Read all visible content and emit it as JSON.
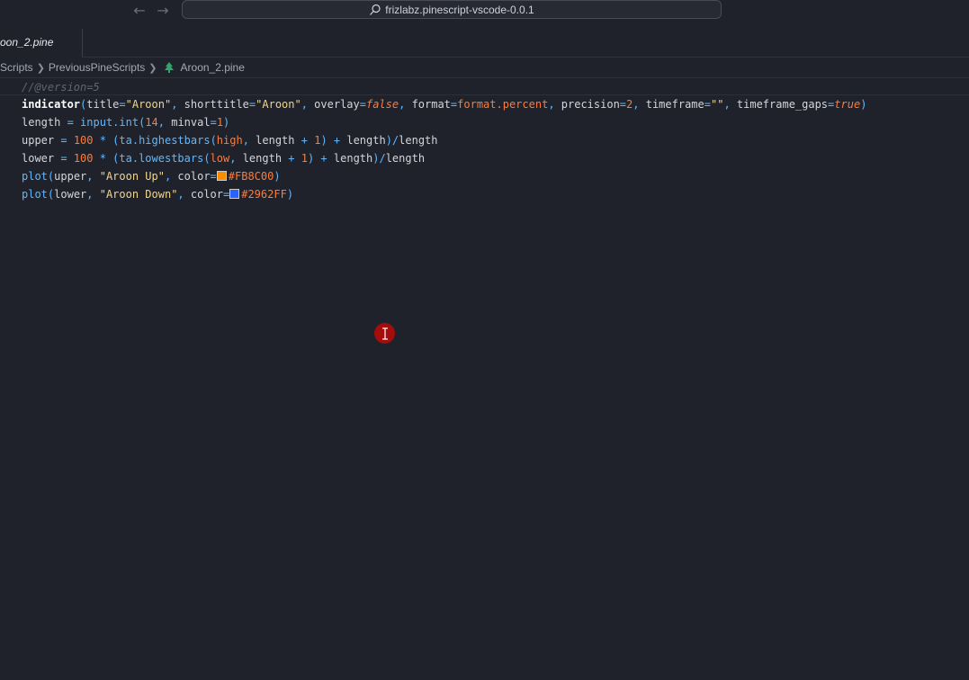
{
  "titlebar": {
    "back_icon": "arrow-left-icon",
    "forward_icon": "arrow-right-icon",
    "search_text": "frizlabz.pinescript-vscode-0.0.1"
  },
  "tab": {
    "label": "oon_2.pine"
  },
  "breadcrumb": {
    "items": [
      "Scripts",
      "PreviousPineScripts",
      "Aroon_2.pine"
    ]
  },
  "editor": {
    "lines": [
      "//@version=5",
      "indicator(title=\"Aroon\", shorttitle=\"Aroon\", overlay=false, format=format.percent, precision=2, timeframe=\"\", timeframe_gaps=true)",
      "length = input.int(14, minval=1)",
      "upper = 100 * (ta.highestbars(high, length + 1) + length)/length",
      "lower = 100 * (ta.lowestbars(low, length + 1) + length)/length",
      "plot(upper, \"Aroon Up\", color=#FB8C00)",
      "plot(lower, \"Aroon Down\", color=#2962FF)"
    ],
    "colors": {
      "up": "#FB8C00",
      "down": "#2962FF"
    }
  },
  "mouse_cursor": {
    "icon": "text-cursor-icon",
    "color": "#a50d0d"
  }
}
